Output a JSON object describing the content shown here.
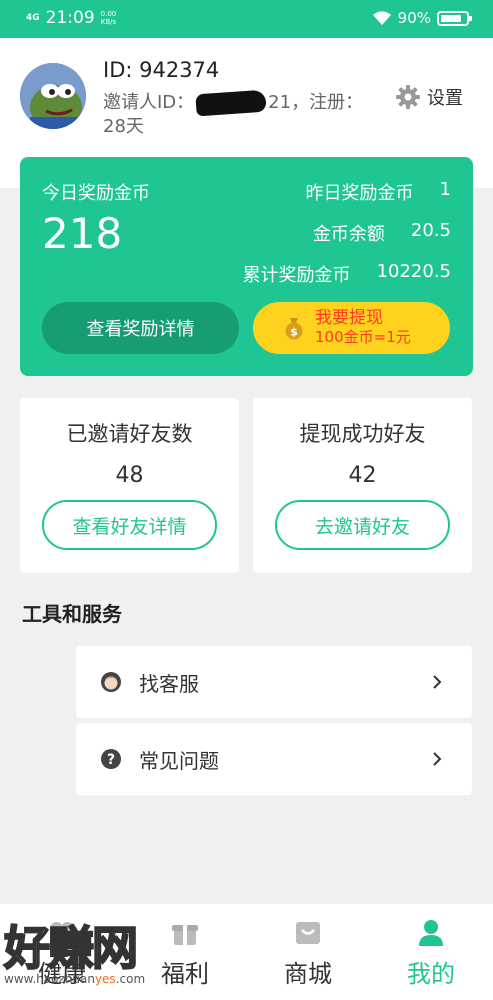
{
  "status_bar": {
    "network": "4G",
    "time": "21:09",
    "speed_value": "0.00",
    "speed_unit": "KB/s",
    "battery": "90%"
  },
  "profile": {
    "id_text": "ID: 942374",
    "inviter_prefix": "邀请人ID：",
    "inviter_suffix": "21，注册：28天",
    "settings_label": "设置"
  },
  "reward": {
    "today_label": "今日奖励金币",
    "today_value": "218",
    "yesterday_label": "昨日奖励金币",
    "yesterday_value": "1",
    "balance_label": "金币余额",
    "balance_value": "20.5",
    "total_label": "累计奖励金币",
    "total_value": "10220.5",
    "detail_button": "查看奖励详情",
    "withdraw_title": "我要提现",
    "withdraw_rate": "100金币=1元"
  },
  "friends": {
    "invited_label": "已邀请好友数",
    "invited_value": "48",
    "invited_button": "查看好友详情",
    "withdrawn_label": "提现成功好友",
    "withdrawn_value": "42",
    "withdrawn_button": "去邀请好友"
  },
  "tools": {
    "title": "工具和服务",
    "items": [
      {
        "label": "找客服",
        "icon": "customer-service-icon"
      },
      {
        "label": "常见问题",
        "icon": "question-icon"
      }
    ]
  },
  "nav": {
    "items": [
      {
        "label": "健康",
        "icon": "health-icon"
      },
      {
        "label": "福利",
        "icon": "gift-icon"
      },
      {
        "label": "商城",
        "icon": "shopping-bag-icon"
      },
      {
        "label": "我的",
        "icon": "person-icon",
        "active": true
      }
    ]
  },
  "watermark": {
    "text": "好赚网",
    "url_prefix": "www.haozhuan",
    "url_highlight": "yes",
    "url_suffix": ".com"
  },
  "colors": {
    "primary": "#1fc592",
    "primary_dark": "#179c74",
    "accent_yellow": "#ffd21f",
    "withdraw_text": "#ff3b1f"
  }
}
